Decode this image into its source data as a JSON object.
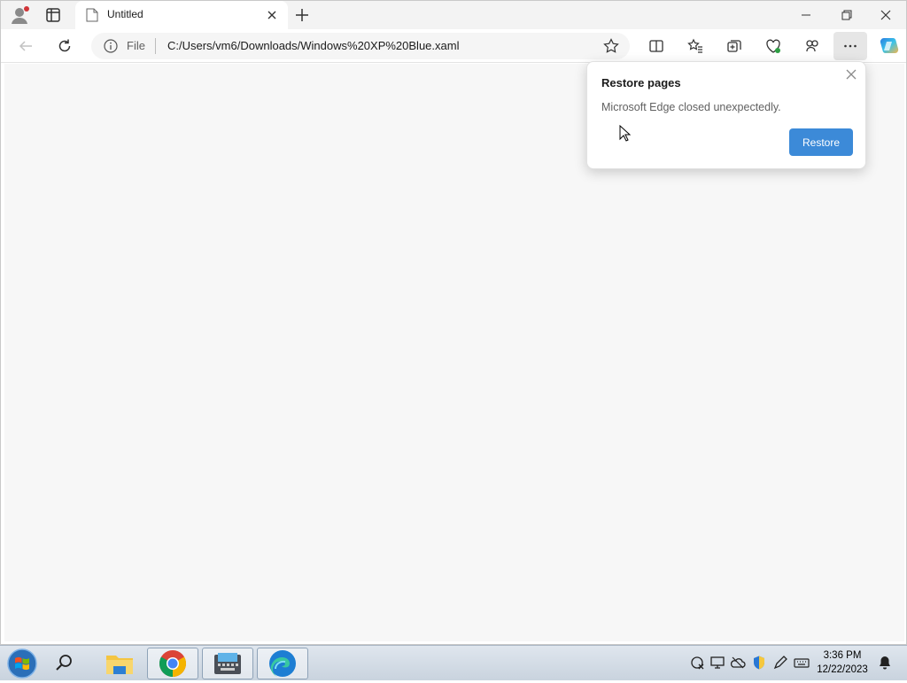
{
  "browser": {
    "tab": {
      "title": "Untitled"
    },
    "omnibox": {
      "scheme_label": "File",
      "url": "C:/Users/vm6/Downloads/Windows%20XP%20Blue.xaml"
    }
  },
  "popup": {
    "title": "Restore pages",
    "message": "Microsoft Edge closed unexpectedly.",
    "restore_label": "Restore"
  },
  "taskbar": {
    "time": "3:36 PM",
    "date": "12/22/2023"
  },
  "colors": {
    "accent": "#3c8ad8",
    "notification_dot": "#d13438"
  }
}
